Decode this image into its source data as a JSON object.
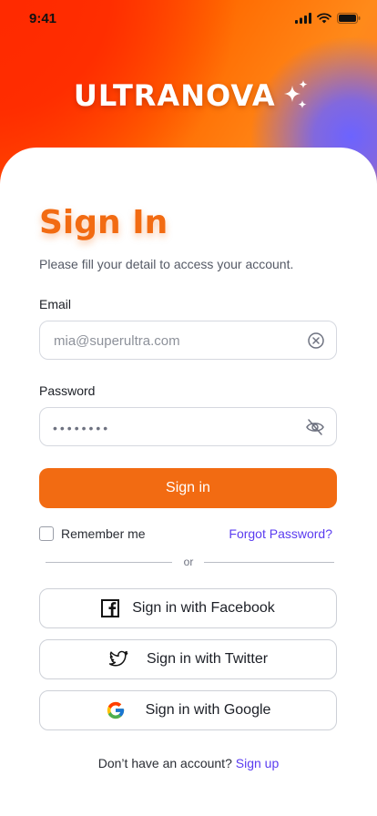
{
  "status_bar": {
    "time": "9:41"
  },
  "brand": {
    "name": "ULTRANOVA"
  },
  "colors": {
    "accent": "#f26b12",
    "link": "#5a3cf0"
  },
  "form": {
    "title": "Sign In",
    "subtitle": "Please fill your detail to access your account.",
    "email": {
      "label": "Email",
      "placeholder": "mia@superultra.com",
      "value": ""
    },
    "password": {
      "label": "Password",
      "masked_value": "••••••••"
    },
    "submit_label": "Sign in",
    "remember_label": "Remember me",
    "remember_checked": false,
    "forgot_label": "Forgot Password?"
  },
  "divider_text": "or",
  "social": {
    "facebook": {
      "label": "Sign in with Facebook",
      "icon": "facebook-icon"
    },
    "twitter": {
      "label": "Sign in with Twitter",
      "icon": "twitter-icon"
    },
    "google": {
      "label": "Sign in with Google",
      "icon": "google-icon"
    }
  },
  "footer": {
    "prompt": "Don’t have an account?",
    "link": "Sign up"
  }
}
